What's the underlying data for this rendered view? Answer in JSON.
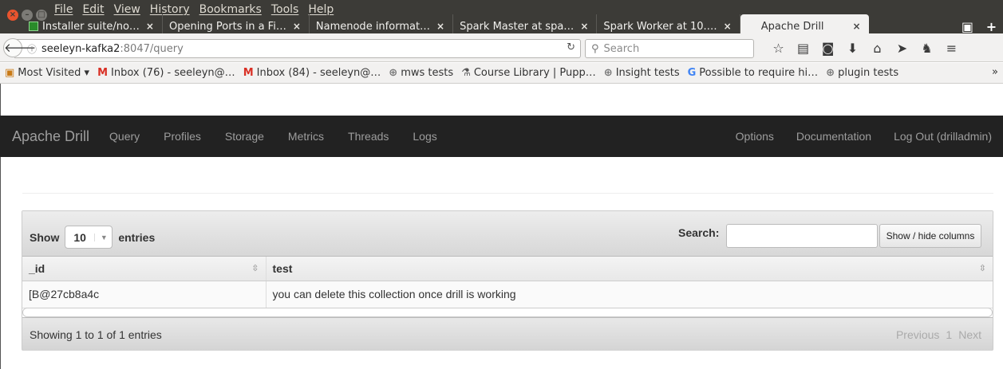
{
  "menubar": [
    "File",
    "Edit",
    "View",
    "History",
    "Bookmarks",
    "Tools",
    "Help"
  ],
  "tabs": [
    {
      "label": "Installer suite/no…",
      "close": "×"
    },
    {
      "label": "Opening Ports in a Fi…",
      "close": "×"
    },
    {
      "label": "Namenode informat…",
      "close": "×"
    },
    {
      "label": "Spark Master at spa…",
      "close": "×"
    },
    {
      "label": "Spark Worker at 10.…",
      "close": "×"
    },
    {
      "label": "Apache Drill",
      "close": "×",
      "active": true
    }
  ],
  "url": {
    "host": "seeleyn-kafka2",
    "rest": ":8047/query"
  },
  "search": {
    "placeholder": "Search"
  },
  "bookmarks": [
    {
      "icon": "folder-icon",
      "label": "Most Visited ▾"
    },
    {
      "icon": "gmail-icon",
      "label": "Inbox (76) - seeleyn@…"
    },
    {
      "icon": "gmail-icon",
      "label": "Inbox (84) - seeleyn@…"
    },
    {
      "icon": "globe-icon",
      "label": "mws tests"
    },
    {
      "icon": "flask-icon",
      "label": "Course Library | Pupp…"
    },
    {
      "icon": "globe-icon",
      "label": "Insight tests"
    },
    {
      "icon": "google-icon",
      "label": "Possible to require hi…"
    },
    {
      "icon": "globe-icon",
      "label": "plugin tests"
    }
  ],
  "drill": {
    "brand": "Apache Drill",
    "links": [
      "Query",
      "Profiles",
      "Storage",
      "Metrics",
      "Threads",
      "Logs"
    ],
    "right_links": [
      "Options",
      "Documentation",
      "Log Out (drilladmin)"
    ]
  },
  "datatable": {
    "show_label": "Show",
    "length_value": "10",
    "entries_label": "entries",
    "search_label": "Search:",
    "colvis_label": "Show / hide columns",
    "columns": [
      "_id",
      "test"
    ],
    "rows": [
      [
        "[B@27cb8a4c",
        "you can delete this collection once drill is working"
      ]
    ],
    "info": "Showing 1 to 1 of 1 entries",
    "pager": {
      "previous": "Previous",
      "page": "1",
      "next": "Next"
    }
  }
}
